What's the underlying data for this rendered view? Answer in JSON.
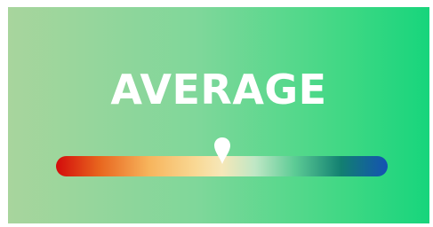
{
  "rating": {
    "label": "AVERAGE",
    "position": 0.5
  },
  "colors": {
    "background_start": "#a8d59d",
    "background_end": "#17d57c",
    "scale_low": "#d30b0b",
    "scale_mid": "#f9d894",
    "scale_high": "#1452b3",
    "marker": "#ffffff"
  },
  "icons": {
    "marker": "map-pin-icon"
  }
}
